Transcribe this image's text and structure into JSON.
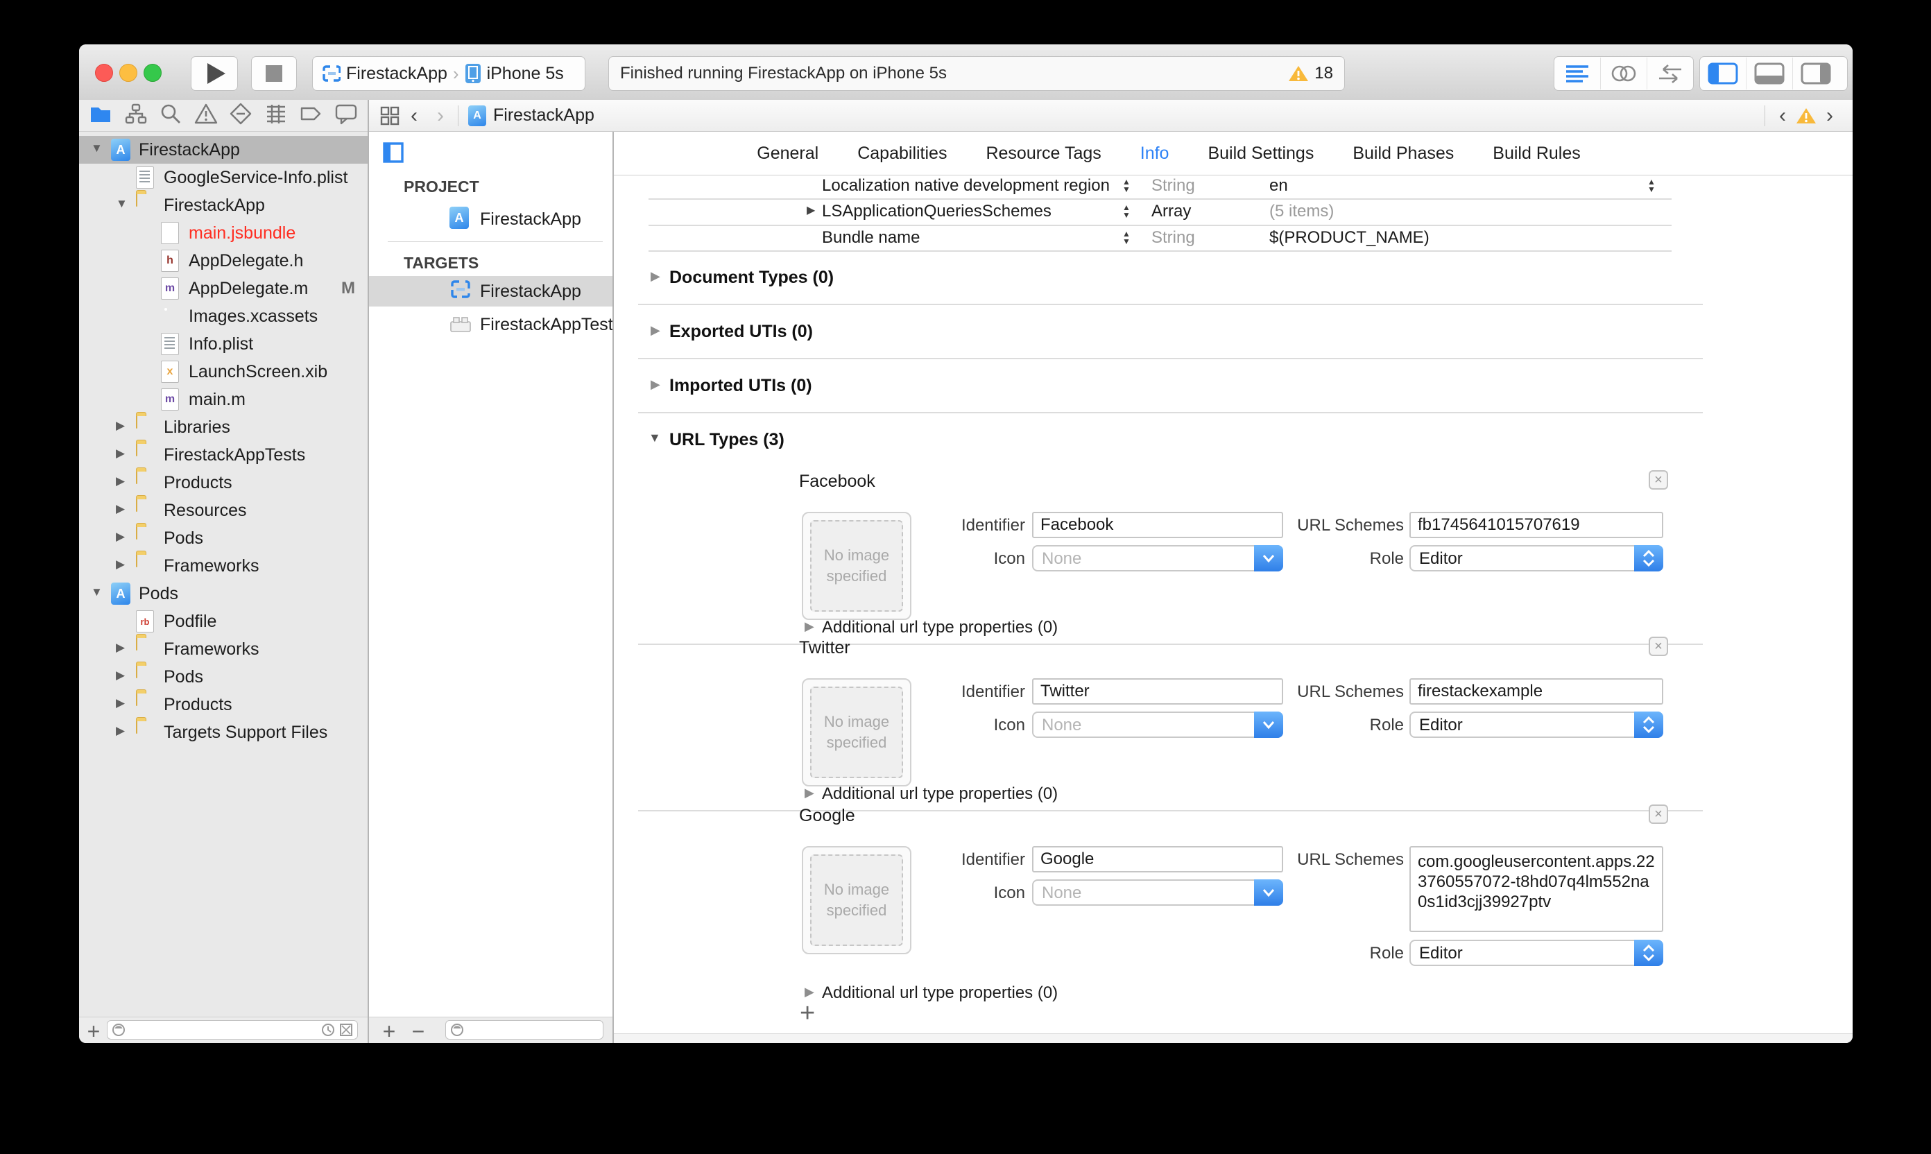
{
  "colors": {
    "accent": "#3b99fc",
    "warning": "#f8b93b",
    "active_tab": "#2d82f6",
    "error_file": "#ff2d21"
  },
  "toolbar": {
    "scheme": {
      "app": "FirestackApp",
      "device": "iPhone 5s"
    },
    "status_message": "Finished running FirestackApp on iPhone 5s",
    "warning_count": "18"
  },
  "navigator_files": [
    {
      "label": "FirestackApp",
      "icon": "project",
      "indent": 0,
      "disclosure": "open",
      "selected": true
    },
    {
      "label": "GoogleService-Info.plist",
      "icon": "plist",
      "indent": 1
    },
    {
      "label": "FirestackApp",
      "icon": "folder",
      "indent": 1,
      "disclosure": "open"
    },
    {
      "label": "main.jsbundle",
      "icon": "page",
      "indent": 2,
      "color": "#ff2d21"
    },
    {
      "label": "AppDelegate.h",
      "icon": "page-h",
      "indent": 2,
      "icon_text": "h"
    },
    {
      "label": "AppDelegate.m",
      "icon": "page-m",
      "indent": 2,
      "icon_text": "m",
      "badge": "M"
    },
    {
      "label": "Images.xcassets",
      "icon": "assets",
      "indent": 2
    },
    {
      "label": "Info.plist",
      "icon": "plist",
      "indent": 2
    },
    {
      "label": "LaunchScreen.xib",
      "icon": "page-x",
      "indent": 2,
      "icon_text": "x"
    },
    {
      "label": "main.m",
      "icon": "page-m",
      "indent": 2,
      "icon_text": "m"
    },
    {
      "label": "Libraries",
      "icon": "folder",
      "indent": 1,
      "disclosure": "closed"
    },
    {
      "label": "FirestackAppTests",
      "icon": "folder",
      "indent": 1,
      "disclosure": "closed"
    },
    {
      "label": "Products",
      "icon": "folder",
      "indent": 1,
      "disclosure": "closed"
    },
    {
      "label": "Resources",
      "icon": "folder",
      "indent": 1,
      "disclosure": "closed"
    },
    {
      "label": "Pods",
      "icon": "folder",
      "indent": 1,
      "disclosure": "closed"
    },
    {
      "label": "Frameworks",
      "icon": "folder",
      "indent": 1,
      "disclosure": "closed"
    },
    {
      "label": "Pods",
      "icon": "project",
      "indent": 0,
      "disclosure": "open"
    },
    {
      "label": "Podfile",
      "icon": "page-rb",
      "indent": 1,
      "icon_text": "rb"
    },
    {
      "label": "Frameworks",
      "icon": "folder",
      "indent": 1,
      "disclosure": "closed"
    },
    {
      "label": "Pods",
      "icon": "folder",
      "indent": 1,
      "disclosure": "closed"
    },
    {
      "label": "Products",
      "icon": "folder",
      "indent": 1,
      "disclosure": "closed"
    },
    {
      "label": "Targets Support Files",
      "icon": "folder",
      "indent": 1,
      "disclosure": "closed"
    }
  ],
  "targets_pane": {
    "project_label": "PROJECT",
    "project_name": "FirestackApp",
    "targets_label": "TARGETS",
    "targets": [
      {
        "name": "FirestackApp",
        "selected": true
      },
      {
        "name": "FirestackAppTests",
        "selected": false
      }
    ]
  },
  "jumpbar": {
    "file": "FirestackApp"
  },
  "tabs": [
    {
      "label": "General",
      "active": false
    },
    {
      "label": "Capabilities",
      "active": false
    },
    {
      "label": "Resource Tags",
      "active": false
    },
    {
      "label": "Info",
      "active": true
    },
    {
      "label": "Build Settings",
      "active": false
    },
    {
      "label": "Build Phases",
      "active": false
    },
    {
      "label": "Build Rules",
      "active": false
    }
  ],
  "plist_rows": [
    {
      "key": "Localization native development region",
      "type": "String",
      "type_muted": true,
      "value": "en",
      "value_muted": false,
      "disclosure": false,
      "value_stepper": true
    },
    {
      "key": "LSApplicationQueriesSchemes",
      "type": "Array",
      "type_muted": false,
      "value": "(5 items)",
      "value_muted": true,
      "disclosure": true,
      "value_stepper": false
    },
    {
      "key": "Bundle name",
      "type": "String",
      "type_muted": true,
      "value": "$(PRODUCT_NAME)",
      "value_muted": false,
      "disclosure": false,
      "value_stepper": false
    }
  ],
  "collapsed_sections": [
    {
      "label": "Document Types (0)"
    },
    {
      "label": "Exported UTIs (0)"
    },
    {
      "label": "Imported UTIs (0)"
    }
  ],
  "url_types": {
    "header": "URL Types (3)",
    "image_placeholder": "No image specified",
    "labels": {
      "identifier": "Identifier",
      "url_schemes": "URL Schemes",
      "icon": "Icon",
      "role": "Role"
    },
    "additional_label": "Additional url type properties (0)",
    "entries": [
      {
        "title": "Facebook",
        "identifier": "Facebook",
        "url_schemes": "fb1745641015707619",
        "icon": "None",
        "role": "Editor"
      },
      {
        "title": "Twitter",
        "identifier": "Twitter",
        "url_schemes": "firestackexample",
        "icon": "None",
        "role": "Editor"
      },
      {
        "title": "Google",
        "identifier": "Google",
        "url_schemes": "com.googleusercontent.apps.223760557072-t8hd07q4lm552na0s1id3cjj39927ptv",
        "icon": "None",
        "role": "Editor"
      }
    ]
  }
}
